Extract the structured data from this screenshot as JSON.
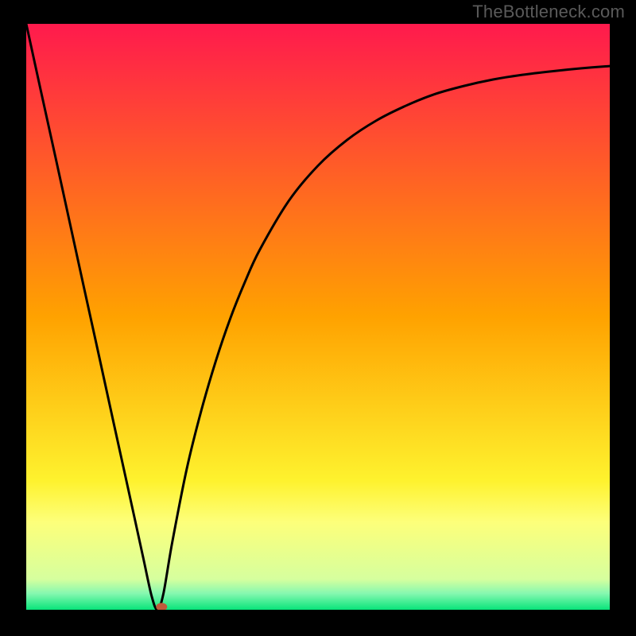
{
  "watermark": "TheBottleneck.com",
  "chart_data": {
    "type": "line",
    "title": "",
    "xlabel": "",
    "ylabel": "",
    "xlim": [
      0,
      100
    ],
    "ylim": [
      0,
      100
    ],
    "grid": false,
    "background_gradient": {
      "stops": [
        {
          "offset": 0.0,
          "color": "#ff1a4d"
        },
        {
          "offset": 0.5,
          "color": "#ffa200"
        },
        {
          "offset": 0.78,
          "color": "#fef22e"
        },
        {
          "offset": 0.85,
          "color": "#fdff7a"
        },
        {
          "offset": 0.948,
          "color": "#d6ff9e"
        },
        {
          "offset": 0.972,
          "color": "#86f8b0"
        },
        {
          "offset": 1.0,
          "color": "#08e47a"
        }
      ]
    },
    "series": [
      {
        "name": "bottleneck-curve",
        "x": [
          0,
          2.5,
          5,
          7.5,
          10,
          12.5,
          15,
          17.5,
          20,
          21.5,
          22.5,
          23.5,
          25,
          27.5,
          30,
          32.5,
          35,
          37.5,
          40,
          45,
          50,
          55,
          60,
          65,
          70,
          75,
          80,
          85,
          90,
          95,
          100
        ],
        "y": [
          100,
          88.6,
          77.3,
          65.9,
          54.5,
          43.2,
          31.8,
          20.5,
          9.1,
          2.3,
          0.0,
          2.7,
          11.4,
          24.0,
          34.0,
          42.5,
          49.8,
          56.0,
          61.4,
          69.8,
          75.8,
          80.2,
          83.5,
          86.0,
          88.0,
          89.4,
          90.5,
          91.3,
          91.9,
          92.4,
          92.8
        ]
      }
    ],
    "marker": {
      "name": "optimum-marker",
      "x": 23.2,
      "y": 0.5,
      "color": "#c05a3a",
      "rx": 7,
      "ry": 5
    }
  }
}
